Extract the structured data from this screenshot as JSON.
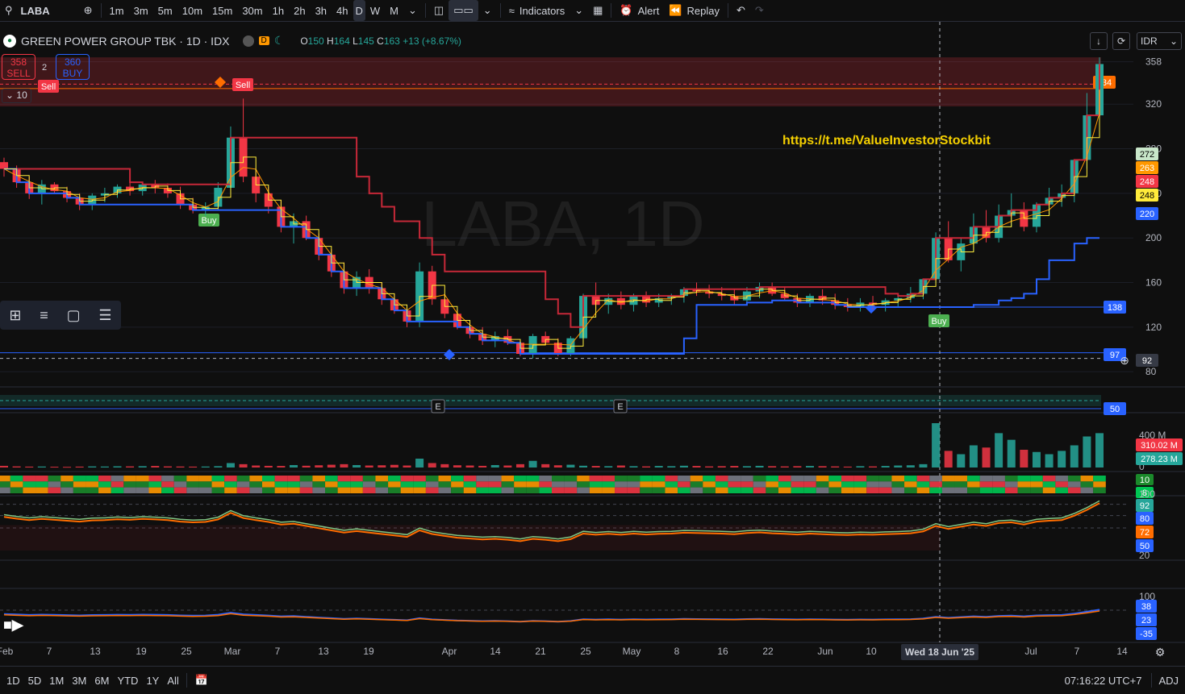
{
  "toolbar": {
    "symbol": "LABA",
    "timeframes": [
      "1m",
      "3m",
      "5m",
      "10m",
      "15m",
      "30m",
      "1h",
      "2h",
      "3h",
      "4h",
      "D",
      "W",
      "M"
    ],
    "active_timeframe": "D",
    "indicators_label": "Indicators",
    "alert_label": "Alert",
    "replay_label": "Replay"
  },
  "header": {
    "title": "GREEN POWER GROUP TBK · 1D · IDX",
    "open_label": "O",
    "open": "150",
    "high_label": "H",
    "high": "164",
    "low_label": "L",
    "low": "145",
    "close_label": "C",
    "close": "163",
    "change": "+13 (+8.67%)",
    "d_badge": "D"
  },
  "order": {
    "sell_price": "358",
    "sell_label": "SELL",
    "spread": "2",
    "buy_price": "360",
    "buy_label": "BUY",
    "qty": "10"
  },
  "currency": "IDR",
  "watermark": "LABA, 1D",
  "annotation_url": "https://t.me/ValueInvestorStockbit",
  "signals": {
    "sell": "Sell",
    "buy": "Buy",
    "earnings": "E"
  },
  "price_axis": {
    "ticks": [
      "358",
      "320",
      "280",
      "240",
      "200",
      "160",
      "120",
      "80"
    ],
    "labels": [
      {
        "text": "334",
        "color": "#ff6d00"
      },
      {
        "text": "272",
        "color": "#c8e6c9"
      },
      {
        "text": "263",
        "color": "#ff9800"
      },
      {
        "text": "248",
        "color": "#f23645"
      },
      {
        "text": "248",
        "color": "#ffeb3b"
      },
      {
        "text": "220",
        "color": "#2962ff"
      },
      {
        "text": "138",
        "color": "#2962ff"
      },
      {
        "text": "97",
        "color": "#2962ff"
      },
      {
        "text": "92",
        "color": "#363a45"
      },
      {
        "text": "50",
        "color": "#2962ff"
      }
    ]
  },
  "volume_axis": {
    "ticks": [
      "400 M",
      "0"
    ],
    "labels": [
      {
        "text": "310.02 M",
        "color": "#f23645"
      },
      {
        "text": "278.23 M",
        "color": "#26a69a"
      }
    ]
  },
  "heat_axis": {
    "labels": [
      {
        "text": "10",
        "color": "#1b8a2b"
      },
      {
        "text": "8",
        "color": "#00c853"
      }
    ]
  },
  "osc1_axis": {
    "ticks": [
      "100",
      "20"
    ],
    "labels": [
      {
        "text": "92",
        "color": "#26a69a"
      },
      {
        "text": "80",
        "color": "#2962ff"
      },
      {
        "text": "72",
        "color": "#ff6d00"
      },
      {
        "text": "50",
        "color": "#2962ff"
      }
    ]
  },
  "osc2_axis": {
    "ticks": [
      "100"
    ],
    "labels": [
      {
        "text": "38",
        "color": "#2962ff"
      },
      {
        "text": "23",
        "color": "#2962ff"
      },
      {
        "text": "-35",
        "color": "#2962ff"
      }
    ]
  },
  "time_axis": {
    "ticks": [
      "Feb",
      "7",
      "13",
      "19",
      "25",
      "Mar",
      "7",
      "13",
      "19",
      "Apr",
      "14",
      "21",
      "25",
      "May",
      "8",
      "16",
      "22",
      "Jun",
      "10",
      "Jul",
      "7",
      "14"
    ],
    "crosshair_label": "Wed 18 Jun '25"
  },
  "bottom": {
    "ranges": [
      "1D",
      "5D",
      "1M",
      "3M",
      "6M",
      "YTD",
      "1Y",
      "All"
    ],
    "clock": "07:16:22 UTC+7",
    "adj": "ADJ"
  },
  "chart_data": {
    "type": "candlestick",
    "title": "GREEN POWER GROUP TBK · 1D · IDX",
    "y_range": [
      70,
      365
    ],
    "x_labels": [
      "Feb",
      "7",
      "13",
      "19",
      "25",
      "Mar",
      "7",
      "13",
      "19",
      "Apr",
      "14",
      "21",
      "25",
      "May",
      "8",
      "16",
      "22",
      "Jun",
      "10",
      "Jul",
      "7",
      "14"
    ],
    "candles_ohlc": [
      [
        268,
        272,
        255,
        262
      ],
      [
        262,
        265,
        245,
        250
      ],
      [
        250,
        255,
        235,
        240
      ],
      [
        240,
        252,
        230,
        248
      ],
      [
        248,
        250,
        240,
        242
      ],
      [
        242,
        246,
        232,
        236
      ],
      [
        236,
        240,
        225,
        230
      ],
      [
        230,
        240,
        225,
        238
      ],
      [
        238,
        245,
        232,
        240
      ],
      [
        240,
        248,
        236,
        246
      ],
      [
        246,
        250,
        238,
        242
      ],
      [
        242,
        250,
        238,
        248
      ],
      [
        248,
        252,
        240,
        245
      ],
      [
        245,
        249,
        236,
        240
      ],
      [
        240,
        246,
        226,
        230
      ],
      [
        230,
        236,
        222,
        225
      ],
      [
        225,
        232,
        220,
        228
      ],
      [
        228,
        250,
        225,
        245
      ],
      [
        245,
        300,
        240,
        290
      ],
      [
        290,
        325,
        250,
        255
      ],
      [
        255,
        262,
        232,
        240
      ],
      [
        240,
        246,
        222,
        228
      ],
      [
        228,
        234,
        205,
        210
      ],
      [
        210,
        222,
        195,
        215
      ],
      [
        215,
        220,
        198,
        200
      ],
      [
        200,
        204,
        180,
        185
      ],
      [
        185,
        190,
        165,
        170
      ],
      [
        170,
        178,
        150,
        155
      ],
      [
        155,
        170,
        148,
        165
      ],
      [
        165,
        172,
        150,
        155
      ],
      [
        155,
        160,
        140,
        145
      ],
      [
        145,
        150,
        132,
        135
      ],
      [
        135,
        140,
        120,
        125
      ],
      [
        125,
        178,
        120,
        170
      ],
      [
        170,
        175,
        140,
        145
      ],
      [
        145,
        150,
        128,
        132
      ],
      [
        132,
        136,
        118,
        120
      ],
      [
        120,
        126,
        110,
        114
      ],
      [
        114,
        120,
        104,
        108
      ],
      [
        108,
        116,
        102,
        112
      ],
      [
        112,
        118,
        104,
        106
      ],
      [
        106,
        108,
        94,
        96
      ],
      [
        96,
        114,
        92,
        112
      ],
      [
        112,
        116,
        104,
        106
      ],
      [
        106,
        110,
        94,
        96
      ],
      [
        96,
        112,
        94,
        110
      ],
      [
        110,
        150,
        106,
        148
      ],
      [
        148,
        160,
        136,
        140
      ],
      [
        140,
        150,
        132,
        146
      ],
      [
        146,
        152,
        136,
        140
      ],
      [
        140,
        150,
        134,
        148
      ],
      [
        148,
        152,
        138,
        142
      ],
      [
        142,
        150,
        138,
        146
      ],
      [
        146,
        150,
        140,
        148
      ],
      [
        148,
        156,
        142,
        154
      ],
      [
        154,
        160,
        148,
        152
      ],
      [
        152,
        158,
        146,
        150
      ],
      [
        150,
        156,
        144,
        148
      ],
      [
        148,
        154,
        140,
        144
      ],
      [
        144,
        156,
        140,
        152
      ],
      [
        152,
        160,
        146,
        156
      ],
      [
        156,
        160,
        148,
        150
      ],
      [
        150,
        156,
        144,
        146
      ],
      [
        146,
        150,
        138,
        142
      ],
      [
        142,
        150,
        138,
        148
      ],
      [
        148,
        154,
        140,
        144
      ],
      [
        144,
        150,
        136,
        140
      ],
      [
        140,
        146,
        134,
        138
      ],
      [
        138,
        146,
        134,
        142
      ],
      [
        142,
        148,
        136,
        140
      ],
      [
        140,
        146,
        134,
        144
      ],
      [
        144,
        148,
        138,
        146
      ],
      [
        146,
        156,
        142,
        150
      ],
      [
        150,
        162,
        145,
        163
      ],
      [
        163,
        205,
        160,
        200
      ],
      [
        200,
        215,
        178,
        180
      ],
      [
        180,
        200,
        170,
        195
      ],
      [
        195,
        222,
        188,
        210
      ],
      [
        210,
        225,
        196,
        200
      ],
      [
        200,
        230,
        196,
        220
      ],
      [
        220,
        240,
        210,
        225
      ],
      [
        225,
        232,
        206,
        210
      ],
      [
        210,
        232,
        205,
        230
      ],
      [
        230,
        245,
        220,
        236
      ],
      [
        236,
        248,
        228,
        240
      ],
      [
        240,
        262,
        232,
        270
      ],
      [
        270,
        330,
        262,
        310
      ],
      [
        310,
        362,
        290,
        356
      ]
    ],
    "volume_millions": [
      15,
      10,
      8,
      9,
      7,
      6,
      8,
      10,
      9,
      11,
      10,
      12,
      14,
      10,
      9,
      8,
      9,
      12,
      40,
      30,
      18,
      15,
      14,
      22,
      16,
      20,
      25,
      30,
      22,
      18,
      20,
      24,
      18,
      80,
      40,
      30,
      20,
      18,
      15,
      22,
      18,
      30,
      60,
      30,
      20,
      25,
      16,
      14,
      12,
      18,
      12,
      10,
      14,
      12,
      16,
      14,
      10,
      12,
      14,
      12,
      15,
      12,
      10,
      12,
      14,
      12,
      10,
      8,
      12,
      10,
      14,
      18,
      20,
      30,
      400,
      150,
      120,
      200,
      180,
      310,
      250,
      160,
      140,
      120,
      150,
      200,
      280,
      310
    ]
  }
}
